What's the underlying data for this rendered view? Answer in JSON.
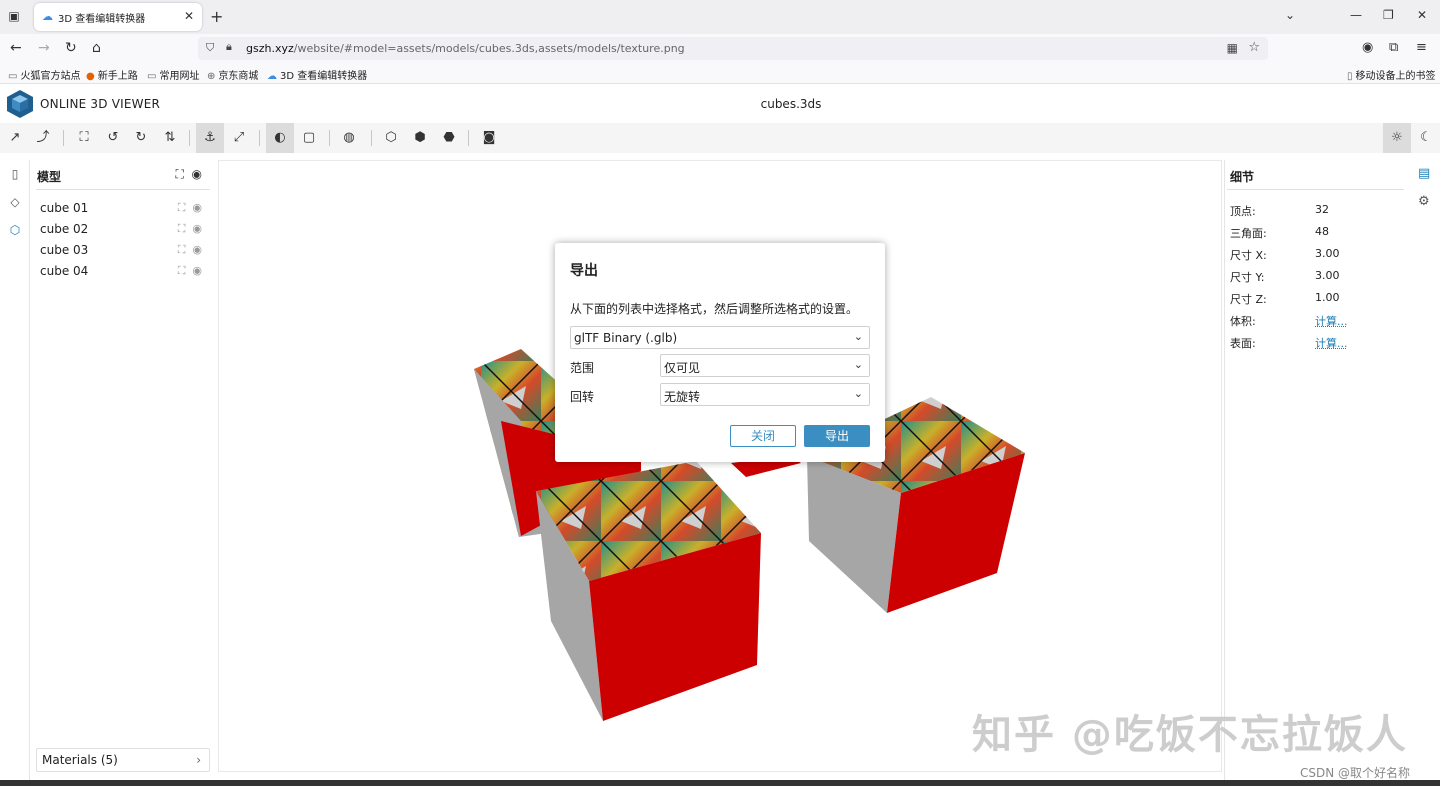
{
  "browser": {
    "tab_title": "3D 查看编辑转换器",
    "url_host": "gszh.xyz",
    "url_path": "/website/#model=assets/models/cubes.3ds,assets/models/texture.png",
    "bookmarks": [
      "火狐官方站点",
      "新手上路",
      "常用网址",
      "京东商城",
      "3D 查看编辑转换器"
    ],
    "mobile_bookmarks": "移动设备上的书签"
  },
  "app": {
    "brand": "ONLINE 3D VIEWER",
    "file_name": "cubes.3ds"
  },
  "left_panel": {
    "title": "模型",
    "items": [
      {
        "label": "cube 01"
      },
      {
        "label": "cube 02"
      },
      {
        "label": "cube 03"
      },
      {
        "label": "cube 04"
      }
    ],
    "materials_label": "Materials (5)"
  },
  "right_panel": {
    "title": "细节",
    "rows": [
      {
        "key": "顶点:",
        "value": "32"
      },
      {
        "key": "三角面:",
        "value": "48"
      },
      {
        "key": "尺寸 X:",
        "value": "3.00"
      },
      {
        "key": "尺寸 Y:",
        "value": "3.00"
      },
      {
        "key": "尺寸 Z:",
        "value": "1.00"
      },
      {
        "key": "体积:",
        "value": "计算..."
      },
      {
        "key": "表面:",
        "value": "计算..."
      }
    ]
  },
  "dialog": {
    "title": "导出",
    "description": "从下面的列表中选择格式，然后调整所选格式的设置。",
    "format_value": "glTF Binary (.glb)",
    "scope_label": "范围",
    "scope_value": "仅可见",
    "rotation_label": "回转",
    "rotation_value": "无旋转",
    "close_label": "关闭",
    "export_label": "导出"
  },
  "overlay": {
    "watermark": "知乎 @吃饭不忘拉饭人",
    "csdn": "CSDN @取个好名称"
  },
  "colors": {
    "accent": "#3b8ec2",
    "cube_red": "#cc0000",
    "cube_gray": "#a6a6a6"
  }
}
